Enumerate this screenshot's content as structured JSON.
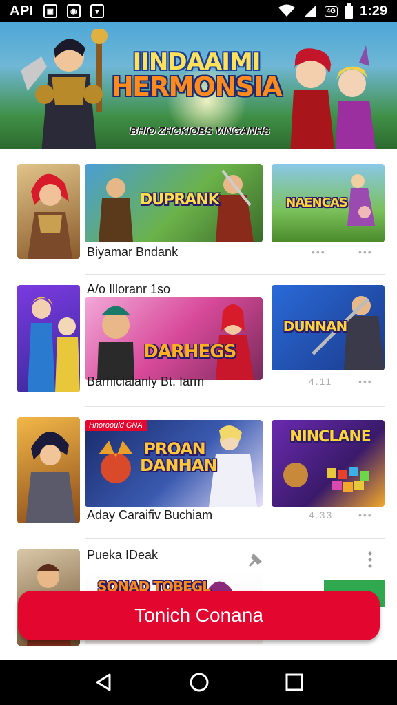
{
  "status_bar": {
    "carrier": "API",
    "icons": [
      "gallery-icon",
      "camera-icon",
      "download-icon"
    ],
    "badge": "4G",
    "time": "1:29"
  },
  "hero": {
    "title_line1": "IINDAAIMI",
    "title_line2": "HERMONSIA",
    "subtitle": "BHIO ZHCKIOBS VINGANHS"
  },
  "rows": [
    {
      "caption": "Biyamar Bndank",
      "tiles": [
        {
          "art_text": "DUPRANK"
        },
        {
          "art_text": "NAENCAS"
        }
      ],
      "meta_a": "•••",
      "meta_b": "•••"
    },
    {
      "caption_top": "A/o Illoranr 1so",
      "caption": "Barhlclalanly Bt. Iarm",
      "tiles": [
        {
          "art_text": "DARHEGS"
        },
        {
          "art_text": "DUNNAN"
        }
      ],
      "meta_a": "4.11",
      "meta_b": "•••"
    },
    {
      "caption": "Aday Caraifiv Buchiam",
      "tag": "Hnoroould GNA",
      "tiles": [
        {
          "art_text": "PROAN DANHAN"
        },
        {
          "art_text": "NINCLANE"
        }
      ],
      "meta_a": "4.33",
      "meta_b": "•••"
    },
    {
      "caption_top": "Pueka IDeak",
      "tiles": [
        {
          "art_text": "SONAD TOBEGL"
        }
      ]
    }
  ],
  "cta": {
    "label": "Tonich Conana"
  },
  "colors": {
    "accent": "#e3062e",
    "status_bar": "#000000",
    "green": "#2fa84f"
  }
}
